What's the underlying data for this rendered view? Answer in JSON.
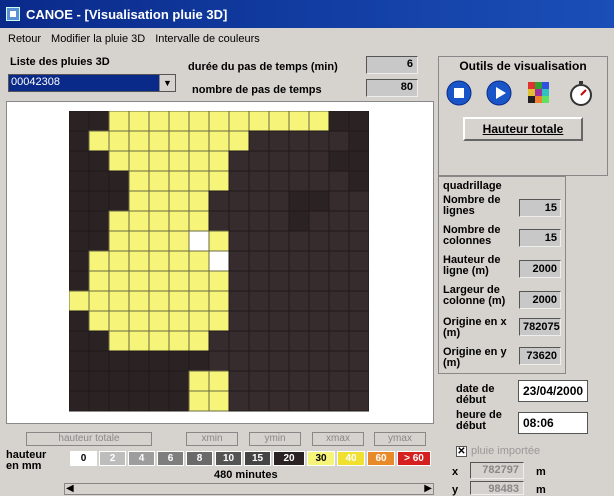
{
  "window": {
    "title": "CANOE - [Visualisation pluie 3D]"
  },
  "menu": {
    "items": [
      "Retour",
      "Modifier la pluie 3D",
      "Intervalle de couleurs"
    ]
  },
  "left": {
    "list_label": "Liste des pluies 3D",
    "list_value": "00042308",
    "duree_label": "durée du pas de temps (min)",
    "duree_value": "6",
    "nombre_label": "nombre de pas de temps",
    "nombre_value": "80"
  },
  "tools": {
    "title": "Outils de visualisation",
    "hauteur_totale": "Hauteur totale"
  },
  "quadrillage": {
    "title": "quadrillage",
    "rows": [
      {
        "label": "Nombre de lignes",
        "value": "15"
      },
      {
        "label": "Nombre de colonnes",
        "value": "15"
      },
      {
        "label": "Hauteur de ligne (m)",
        "value": "2000"
      },
      {
        "label": "Largeur de colonne (m)",
        "value": "2000"
      },
      {
        "label": "Origine en x (m)",
        "value": "782075"
      },
      {
        "label": "Origine en y (m)",
        "value": "73620"
      }
    ]
  },
  "dates": {
    "date_label": "date de début",
    "date_value": "23/04/2000",
    "heure_label": "heure de début",
    "heure_value": "08:06"
  },
  "import": {
    "label": "pluie importée",
    "x_label": "x",
    "x_value": "782797",
    "x_unit": "m",
    "y_label": "y",
    "y_value": "98483",
    "y_unit": "m"
  },
  "legend": {
    "buttons": [
      "hauteur totale",
      "xmin",
      "ymin",
      "xmax",
      "ymax"
    ],
    "label": "hauteur en mm",
    "classes": [
      "0",
      "2",
      "4",
      "6",
      "8",
      "10",
      "15",
      "20",
      "30",
      "40",
      "60",
      "> 60"
    ],
    "minutes": "480 minutes"
  },
  "grid": {
    "colors": {
      "Y": "#f7f47a",
      "W": "#ffffff",
      "D": "#2b2224",
      "B": "#4a3a3c",
      "R": "#362b2d"
    },
    "rows": [
      "DDYYYYYYYYYYYDD",
      "DYYYYYYYYRRRRRD",
      "DDYYYYYYRRRRRDD",
      "DDDYYYYYRRRRRRD",
      "DDDYYYYRRRRDDRR",
      "DDYYYYYRRRRDRRR",
      "DDYYYYWYRRRRRRR",
      "DYYYYYYWRRRRRRR",
      "DYYYYYYYRRRRRRR",
      "YYYYYYYYRRRRRRR",
      "DYYYYYYYRRRRRRR",
      "DDYYYYYRRRRRRRR",
      "DDDDDDDRRRRRRRR",
      "DDDDDDYYRRRRRRR",
      "DDDDDDYYRRRRRRR"
    ]
  }
}
